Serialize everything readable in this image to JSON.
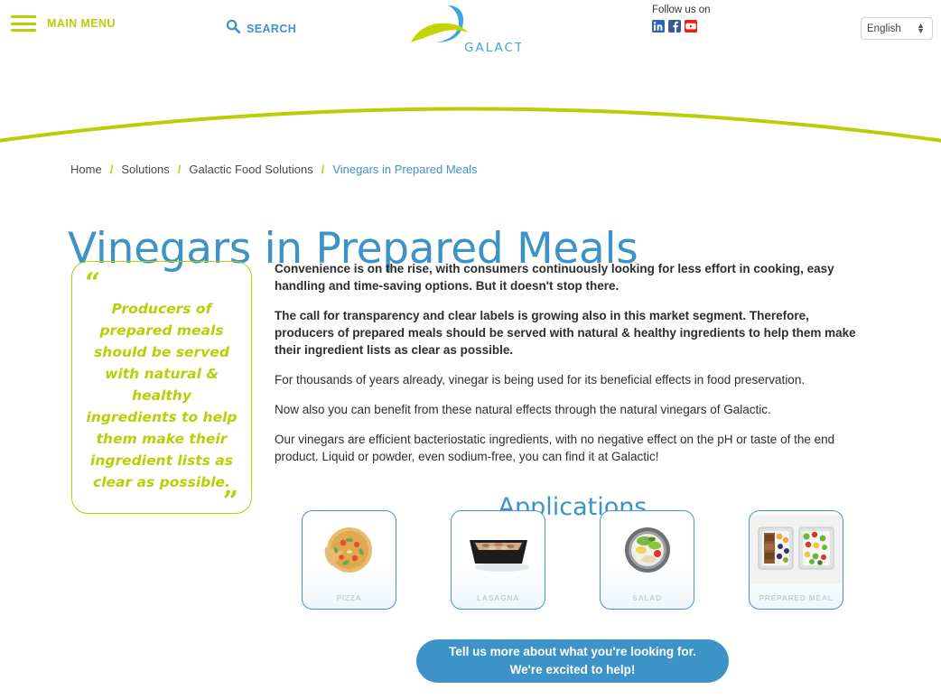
{
  "header": {
    "menu_label": "MAIN MENU",
    "menu_icon": "hamburger-icon",
    "search_label": "SEARCH",
    "search_icon": "search-icon",
    "logo_text": "GALACTIC",
    "follow_label": "Follow us on",
    "social": [
      {
        "name": "linkedin-icon",
        "label": "LinkedIn",
        "color": "#2867b2"
      },
      {
        "name": "facebook-icon",
        "label": "Facebook",
        "color": "#3b5998"
      },
      {
        "name": "youtube-icon",
        "label": "YouTube",
        "color": "#e62117"
      }
    ],
    "language": {
      "selected": "English",
      "options": [
        "English"
      ]
    }
  },
  "breadcrumb": {
    "items": [
      "Home",
      "Solutions",
      "Galactic Food Solutions",
      "Vinegars in Prepared Meals"
    ],
    "separator": "/"
  },
  "main": {
    "title": "Vinegars in Prepared Meals",
    "quote": {
      "open_mark": "“",
      "close_mark": "”",
      "text": "Producers of prepared meals should be served with natural & healthy ingredients to help them make their ingredient lists as clear as possible."
    },
    "paragraphs": [
      {
        "bold": true,
        "text": "Convenience is on the rise, with consumers continuously looking for less effort in cooking, easy handling and time-saving options. But it doesn't stop there."
      },
      {
        "bold": true,
        "text": "The call for transparency and clear labels is growing also in this market segment. Therefore, producers of prepared meals should be served with natural & healthy ingredients to help them make their ingredient lists as clear as possible."
      },
      {
        "bold": false,
        "text": "For thousands of years already, vinegar is being used for its beneficial effects in food preservation."
      },
      {
        "bold": false,
        "text": "Now also you can benefit from these natural effects through the natural vinegars of Galactic."
      },
      {
        "bold": false,
        "text": "Our vinegars are efficient bacteriostatic ingredients, with no negative effect on the pH or taste of the end product. Liquid or powder, even sodium-free, you can find it at Galactic!"
      }
    ],
    "applications_title": "Applications",
    "applications": [
      {
        "label": "PIZZA",
        "icon": "pizza-image"
      },
      {
        "label": "LASAGNA",
        "icon": "lasagna-tray-image"
      },
      {
        "label": "SALAD",
        "icon": "salad-bowl-image"
      },
      {
        "label": "PREPARED MEAL",
        "icon": "prepared-meal-trays-image"
      }
    ],
    "cta": {
      "line1": "Tell us more about what you're looking for.",
      "line2": "We're excited to help!"
    }
  },
  "colors": {
    "brand_blue": "#3d92c8",
    "brand_green": "#b8cf06",
    "card_border": "#4a90d9",
    "text": "#2d2d2d"
  }
}
